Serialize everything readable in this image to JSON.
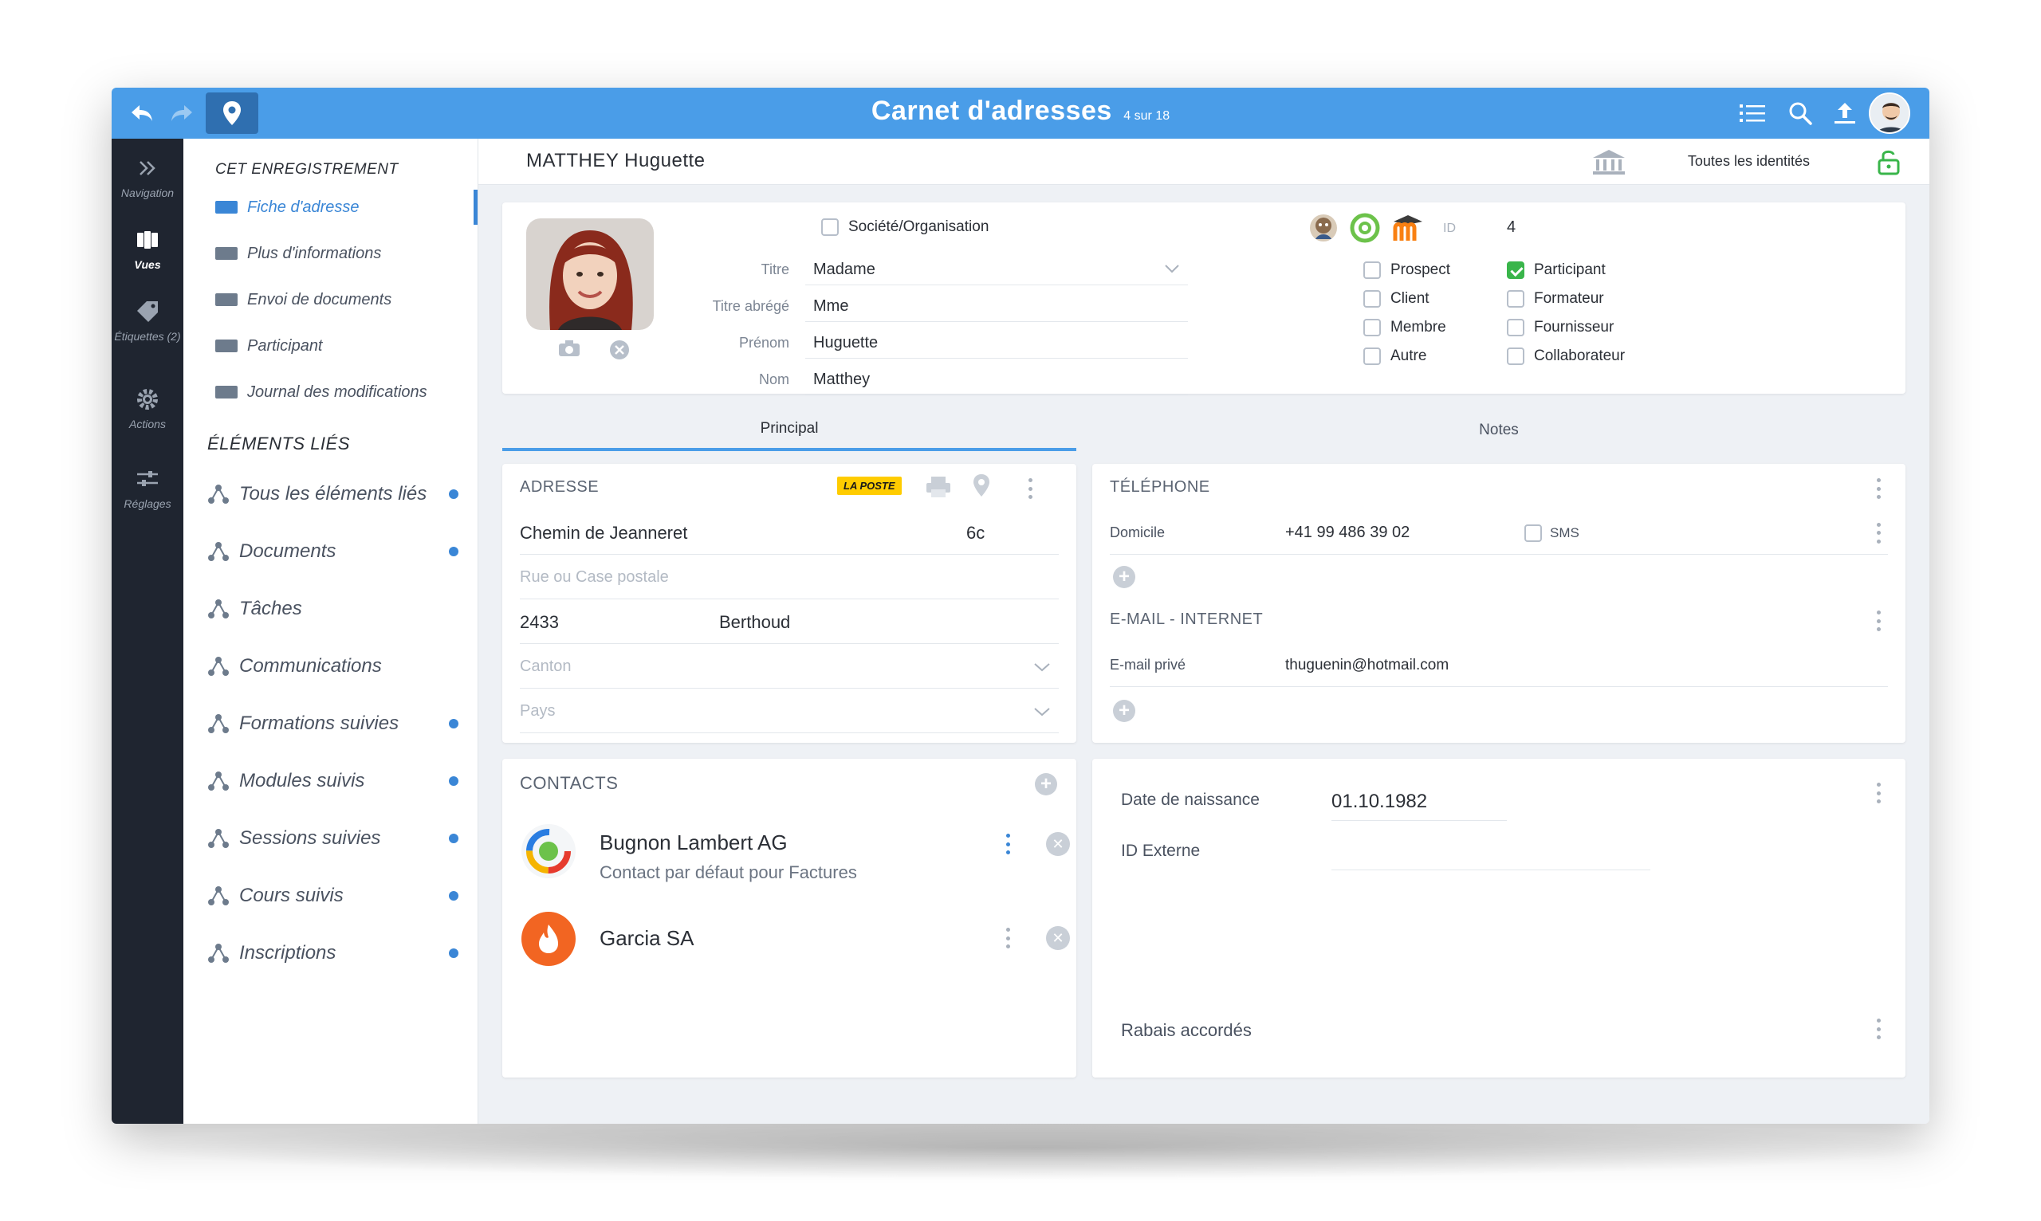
{
  "header": {
    "title": "Carnet d'adresses",
    "count": "4 sur 18"
  },
  "rail": {
    "items": [
      {
        "label": "Navigation",
        "icon": "double-chevron-icon"
      },
      {
        "label": "Vues",
        "icon": "views-icon"
      },
      {
        "label": "Étiquettes (2)",
        "icon": "tag-icon"
      },
      {
        "label": "Actions",
        "icon": "gear-icon"
      },
      {
        "label": "Réglages",
        "icon": "sliders-icon"
      }
    ]
  },
  "leftnav": {
    "record_heading": "CET ENREGISTREMENT",
    "record_items": [
      "Fiche d'adresse",
      "Plus d'informations",
      "Envoi de documents",
      "Participant",
      "Journal des modifications"
    ],
    "linked_heading": "ÉLÉMENTS LIÉS",
    "linked_items": [
      {
        "label": "Tous les éléments liés",
        "dot": true
      },
      {
        "label": "Documents",
        "dot": true
      },
      {
        "label": "Tâches",
        "dot": false
      },
      {
        "label": "Communications",
        "dot": false
      },
      {
        "label": "Formations suivies",
        "dot": true
      },
      {
        "label": "Modules suivis",
        "dot": true
      },
      {
        "label": "Sessions suivies",
        "dot": true
      },
      {
        "label": "Cours suivis",
        "dot": true
      },
      {
        "label": "Inscriptions",
        "dot": true
      }
    ]
  },
  "record": {
    "name": "MATTHEY Huguette",
    "identities": "Toutes les identités"
  },
  "identity": {
    "org_label": "Société/Organisation",
    "fields": [
      {
        "label": "Titre",
        "value": "Madame"
      },
      {
        "label": "Titre abrégé",
        "value": "Mme"
      },
      {
        "label": "Prénom",
        "value": "Huguette"
      },
      {
        "label": "Nom",
        "value": "Matthey"
      }
    ],
    "id_label": "ID",
    "id_value": "4",
    "roles": [
      {
        "label": "Prospect",
        "checked": false
      },
      {
        "label": "Participant",
        "checked": true
      },
      {
        "label": "Client",
        "checked": false
      },
      {
        "label": "Formateur",
        "checked": false
      },
      {
        "label": "Membre",
        "checked": false
      },
      {
        "label": "Fournisseur",
        "checked": false
      },
      {
        "label": "Autre",
        "checked": false
      },
      {
        "label": "Collaborateur",
        "checked": false
      }
    ]
  },
  "tabs": [
    "Principal",
    "Notes"
  ],
  "address": {
    "title": "ADRESSE",
    "poste_badge": "LA POSTE",
    "street": "Chemin de Jeanneret",
    "number": "6c",
    "street2_placeholder": "Rue ou Case postale",
    "zip": "2433",
    "city": "Berthoud",
    "canton_placeholder": "Canton",
    "country_placeholder": "Pays"
  },
  "phone": {
    "title": "TÉLÉPHONE",
    "type": "Domicile",
    "number": "+41 99 486 39 02",
    "sms_label": "SMS"
  },
  "email": {
    "title": "E-MAIL - INTERNET",
    "type": "E-mail privé",
    "address": "thuguenin@hotmail.com"
  },
  "contacts": {
    "title": "CONTACTS",
    "items": [
      {
        "name": "Bugnon Lambert AG",
        "subtitle": "Contact par défaut pour Factures"
      },
      {
        "name": "Garcia SA",
        "subtitle": ""
      }
    ]
  },
  "extra": {
    "birth_label": "Date de naissance",
    "birth_value": "01.10.1982",
    "ext_id_label": "ID Externe",
    "ext_id_value": "",
    "discount_label": "Rabais accordés"
  },
  "colors": {
    "topbar": "#4a9de8",
    "accent": "#3a86d6",
    "rail": "#1f2530",
    "check": "#39b54a"
  }
}
